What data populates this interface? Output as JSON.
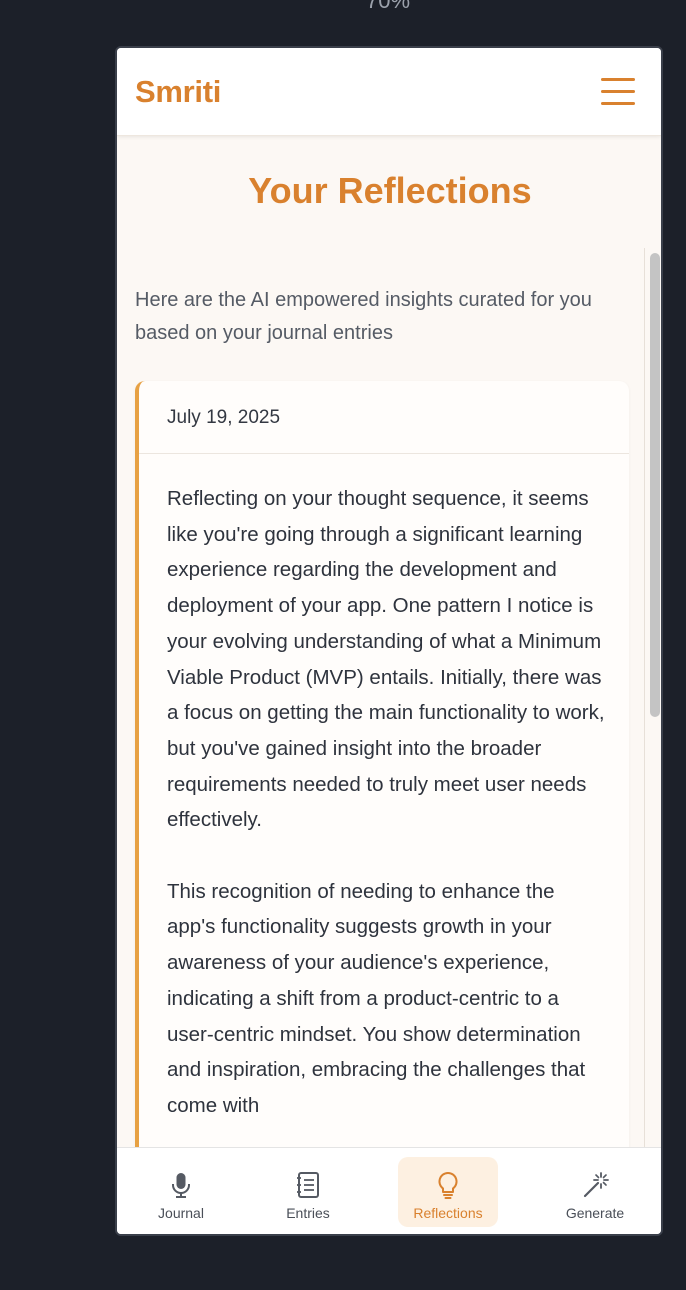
{
  "zoom": "70%",
  "app": {
    "brand": "Smriti"
  },
  "page": {
    "title": "Your Reflections",
    "intro": "Here are the AI empowered insights curated for you based on your journal entries"
  },
  "reflection": {
    "date": "July 19, 2025",
    "paragraphs": [
      "Reflecting on your thought sequence, it seems like you're going through a significant learning experience regarding the development and deployment of your app. One pattern I notice is your evolving understanding of what a Minimum Viable Product (MVP) entails. Initially, there was a focus on getting the main functionality to work, but you've gained insight into the broader requirements needed to truly meet user needs effectively.",
      "This recognition of needing to enhance the app's functionality suggests growth in your awareness of your audience's experience, indicating a shift from a product-centric to a user-centric mindset. You show determination and inspiration, embracing the challenges that come with"
    ]
  },
  "nav": {
    "items": [
      {
        "label": "Journal",
        "icon": "microphone-icon",
        "active": false
      },
      {
        "label": "Entries",
        "icon": "notebook-icon",
        "active": false
      },
      {
        "label": "Reflections",
        "icon": "lightbulb-icon",
        "active": true
      },
      {
        "label": "Generate",
        "icon": "magic-wand-icon",
        "active": false
      }
    ]
  },
  "colors": {
    "accent": "#d9812e",
    "card_border": "#e7a143",
    "active_nav_bg": "#fdf0e1",
    "page_bg": "#1c2029"
  }
}
